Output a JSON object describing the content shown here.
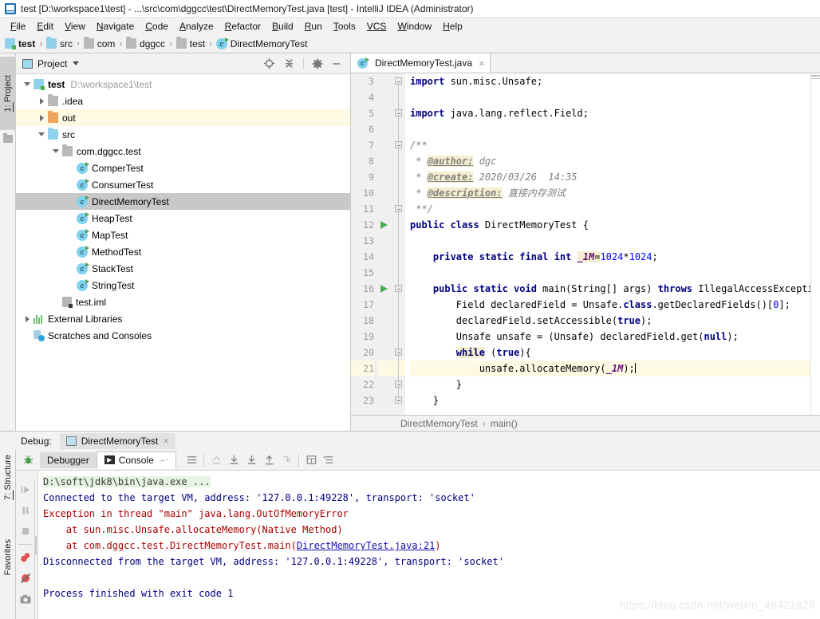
{
  "window": {
    "title": "test [D:\\workspace1\\test] - ...\\src\\com\\dggcc\\test\\DirectMemoryTest.java [test] - IntelliJ IDEA (Administrator)",
    "icon": "intellij-idea-icon"
  },
  "menubar": {
    "items": [
      {
        "mnemonic": "F",
        "rest": "ile"
      },
      {
        "mnemonic": "E",
        "rest": "dit"
      },
      {
        "mnemonic": "V",
        "rest": "iew"
      },
      {
        "mnemonic": "N",
        "rest": "avigate"
      },
      {
        "mnemonic": "C",
        "rest": "ode"
      },
      {
        "mnemonic": "A",
        "rest": "nalyze"
      },
      {
        "mnemonic": "R",
        "rest": "efactor"
      },
      {
        "mnemonic": "B",
        "rest": "uild"
      },
      {
        "mnemonic": "R",
        "rest": "un"
      },
      {
        "mnemonic": "T",
        "rest": "ools"
      },
      {
        "mnemonic": "VCS",
        "rest": ""
      },
      {
        "mnemonic": "W",
        "rest": "indow"
      },
      {
        "mnemonic": "H",
        "rest": "elp"
      }
    ]
  },
  "navbar": {
    "crumbs": [
      {
        "label": "test",
        "icon": "module-icon",
        "bold": true
      },
      {
        "label": "src",
        "icon": "source-folder-icon",
        "bold": false
      },
      {
        "label": "com",
        "icon": "package-folder-icon",
        "bold": false
      },
      {
        "label": "dggcc",
        "icon": "package-folder-icon",
        "bold": false
      },
      {
        "label": "test",
        "icon": "package-folder-icon",
        "bold": false
      },
      {
        "label": "DirectMemoryTest",
        "icon": "java-class-icon",
        "bold": false
      }
    ]
  },
  "tool_strip_left": {
    "project_tab": {
      "number": "1: ",
      "label": "Project"
    }
  },
  "project_panel": {
    "title": "Project",
    "toolbar": [
      {
        "name": "locate-icon"
      },
      {
        "name": "collapse-all-icon"
      },
      {
        "name": "gear-icon"
      },
      {
        "name": "hide-icon"
      }
    ],
    "tree": [
      {
        "depth": 0,
        "twisty": "down",
        "icon": "module-icon",
        "label": "test",
        "bold": true,
        "path": "D:\\workspace1\\test",
        "state": "normal"
      },
      {
        "depth": 1,
        "twisty": "right",
        "icon": "folder-grey-icon",
        "label": ".idea",
        "bold": false,
        "path": "",
        "state": "normal"
      },
      {
        "depth": 1,
        "twisty": "right",
        "icon": "folder-orange-icon",
        "label": "out",
        "bold": false,
        "path": "",
        "state": "highlight"
      },
      {
        "depth": 1,
        "twisty": "down",
        "icon": "source-folder-icon",
        "label": "src",
        "bold": false,
        "path": "",
        "state": "normal"
      },
      {
        "depth": 2,
        "twisty": "down",
        "icon": "package-icon",
        "label": "com.dggcc.test",
        "bold": false,
        "path": "",
        "state": "normal"
      },
      {
        "depth": 3,
        "twisty": "none",
        "icon": "java-class-icon",
        "label": "ComperTest",
        "bold": false,
        "path": "",
        "state": "normal"
      },
      {
        "depth": 3,
        "twisty": "none",
        "icon": "java-class-icon",
        "label": "ConsumerTest",
        "bold": false,
        "path": "",
        "state": "normal"
      },
      {
        "depth": 3,
        "twisty": "none",
        "icon": "java-class-icon",
        "label": "DirectMemoryTest",
        "bold": false,
        "path": "",
        "state": "selected"
      },
      {
        "depth": 3,
        "twisty": "none",
        "icon": "java-class-icon",
        "label": "HeapTest",
        "bold": false,
        "path": "",
        "state": "normal"
      },
      {
        "depth": 3,
        "twisty": "none",
        "icon": "java-class-icon",
        "label": "MapTest",
        "bold": false,
        "path": "",
        "state": "normal"
      },
      {
        "depth": 3,
        "twisty": "none",
        "icon": "java-class-icon",
        "label": "MethodTest",
        "bold": false,
        "path": "",
        "state": "normal"
      },
      {
        "depth": 3,
        "twisty": "none",
        "icon": "java-class-icon",
        "label": "StackTest",
        "bold": false,
        "path": "",
        "state": "normal"
      },
      {
        "depth": 3,
        "twisty": "none",
        "icon": "java-class-icon",
        "label": "StringTest",
        "bold": false,
        "path": "",
        "state": "normal"
      },
      {
        "depth": 2,
        "twisty": "none",
        "icon": "iml-file-icon",
        "label": "test.iml",
        "bold": false,
        "path": "",
        "state": "normal"
      },
      {
        "depth": 0,
        "twisty": "right",
        "icon": "libraries-icon",
        "label": "External Libraries",
        "bold": false,
        "path": "",
        "state": "normal"
      },
      {
        "depth": 0,
        "twisty": "none",
        "icon": "scratches-icon",
        "label": "Scratches and Consoles",
        "bold": false,
        "path": "",
        "state": "normal"
      }
    ]
  },
  "editor": {
    "tab": {
      "label": "DirectMemoryTest.java",
      "icon": "java-class-icon",
      "close": "×"
    },
    "first_line_number": 3,
    "lines": [
      {
        "n": 3,
        "run": false,
        "fold": "start",
        "highlight": false,
        "html": "<span class=\"kw\">import</span> sun.misc.Unsafe;"
      },
      {
        "n": 4,
        "run": false,
        "fold": "none",
        "highlight": false,
        "html": ""
      },
      {
        "n": 5,
        "run": false,
        "fold": "start",
        "highlight": false,
        "html": "<span class=\"kw\">import</span> java.lang.reflect.Field;"
      },
      {
        "n": 6,
        "run": false,
        "fold": "none",
        "highlight": false,
        "html": ""
      },
      {
        "n": 7,
        "run": false,
        "fold": "start",
        "highlight": false,
        "html": "<span class=\"cmt\">/**</span>"
      },
      {
        "n": 8,
        "run": false,
        "fold": "none",
        "highlight": false,
        "html": "<span class=\"cmt\"> * </span><span class=\"tag\">@author:</span><span class=\"cmt\"> dgc</span>"
      },
      {
        "n": 9,
        "run": false,
        "fold": "none",
        "highlight": false,
        "html": "<span class=\"cmt\"> * </span><span class=\"tag\">@create:</span><span class=\"cmt\"> 2020/03/26  14:35</span>"
      },
      {
        "n": 10,
        "run": false,
        "fold": "none",
        "highlight": false,
        "html": "<span class=\"cmt\"> * </span><span class=\"tag\">@description:</span><span class=\"cmt\"> 直接内存测试</span>"
      },
      {
        "n": 11,
        "run": false,
        "fold": "end",
        "highlight": false,
        "html": "<span class=\"cmt\"> **/</span>"
      },
      {
        "n": 12,
        "run": true,
        "fold": "none",
        "highlight": false,
        "html": "<span class=\"kw\">public class</span> DirectMemoryTest {"
      },
      {
        "n": 13,
        "run": false,
        "fold": "none",
        "highlight": false,
        "html": ""
      },
      {
        "n": 14,
        "run": false,
        "fold": "none",
        "highlight": false,
        "html": "    <span class=\"kw\">private static final int</span> <span class=\"fld\">_1M</span><span class=\"hlw\">=</span><span class=\"num\">1024</span>*<span class=\"num\">1024</span>;"
      },
      {
        "n": 15,
        "run": false,
        "fold": "none",
        "highlight": false,
        "html": ""
      },
      {
        "n": 16,
        "run": true,
        "fold": "start",
        "highlight": false,
        "html": "    <span class=\"kw\">public static void</span> main(String[] args) <span class=\"kw\">throws</span> IllegalAccessException {"
      },
      {
        "n": 17,
        "run": false,
        "fold": "none",
        "highlight": false,
        "html": "        Field declaredField = Unsafe.<span class=\"kw\">class</span>.getDeclaredFields()[<span class=\"num\">0</span>];"
      },
      {
        "n": 18,
        "run": false,
        "fold": "none",
        "highlight": false,
        "html": "        declaredField.setAccessible(<span class=\"kw\">true</span>);"
      },
      {
        "n": 19,
        "run": false,
        "fold": "none",
        "highlight": false,
        "html": "        Unsafe unsafe = (Unsafe) declaredField.get(<span class=\"kw\">null</span>);"
      },
      {
        "n": 20,
        "run": false,
        "fold": "start",
        "highlight": false,
        "html": "        <span class=\"kw hlw\">while</span> (<span class=\"kw\">true</span>){"
      },
      {
        "n": 21,
        "run": false,
        "fold": "none",
        "highlight": true,
        "html": "            unsafe.allocateMemory(<span class=\"fldp\">_1M</span>);<span class=\"caret\"></span>"
      },
      {
        "n": 22,
        "run": false,
        "fold": "end",
        "highlight": false,
        "html": "        }"
      },
      {
        "n": 23,
        "run": false,
        "fold": "end",
        "highlight": false,
        "html": "    }"
      }
    ],
    "breadcrumb_bottom": [
      "DirectMemoryTest",
      "main()"
    ]
  },
  "debug_panel": {
    "header_label": "Debug:",
    "session_tab": {
      "label": "DirectMemoryTest",
      "close": "×"
    },
    "tabs": [
      {
        "label": "Debugger",
        "active": false,
        "icon": null
      },
      {
        "label": "Console",
        "active": true,
        "icon": "console-icon",
        "suffix": "→·"
      }
    ],
    "toolbar_icons": [
      "menu-icon",
      "rerun-icon",
      "step-over-icon",
      "step-into-icon",
      "step-out-icon",
      "run-to-cursor-icon",
      "evaluate-icon",
      "soft-wrap-icon"
    ],
    "side_tools": [
      {
        "name": "up-icon",
        "selected": false
      },
      {
        "name": "down-icon",
        "selected": false
      },
      {
        "name": "soft-wrap-icon",
        "selected": false
      },
      {
        "name": "scroll-to-end-icon",
        "selected": true
      },
      {
        "name": "print-icon",
        "selected": false
      },
      {
        "name": "trash-icon",
        "selected": false
      }
    ],
    "left_strip_tools": [
      {
        "name": "resume-icon"
      },
      {
        "name": "pause-icon"
      },
      {
        "name": "stop-icon"
      },
      {
        "name": "breakpoints-icon"
      },
      {
        "name": "mute-breakpoints-icon"
      },
      {
        "name": "camera-icon"
      }
    ],
    "structure_tab": {
      "number": "7: ",
      "label": "Structure"
    },
    "favorites_tab": {
      "label": "Favorites"
    },
    "console_lines": [
      {
        "text": "D:\\soft\\jdk8\\bin\\java.exe ...",
        "style": "cmd"
      },
      {
        "text": "Connected to the target VM, address: '127.0.0.1:49228', transport: 'socket'",
        "style": "blue"
      },
      {
        "text": "Exception in thread \"main\" java.lang.OutOfMemoryError",
        "style": "red"
      },
      {
        "text": "    at sun.misc.Unsafe.allocateMemory(Native Method)",
        "style": "red"
      },
      {
        "text": "    at com.dggcc.test.DirectMemoryTest.main(",
        "style": "red",
        "link": "DirectMemoryTest.java:21",
        "tail": ")"
      },
      {
        "text": "Disconnected from the target VM, address: '127.0.0.1:49228', transport: 'socket'",
        "style": "blue"
      },
      {
        "text": "",
        "style": "blank"
      },
      {
        "text": "Process finished with exit code 1",
        "style": "blue"
      }
    ]
  },
  "watermark": {
    "text": "https://blog.csdn.net/weixin_46421629"
  },
  "colors": {
    "accent_blue": "#000080",
    "error_red": "#aa0000",
    "selection_grey": "#c8c8c8",
    "highlight_yellow": "#fdf9e3",
    "link_blue": "#1a0dab"
  }
}
